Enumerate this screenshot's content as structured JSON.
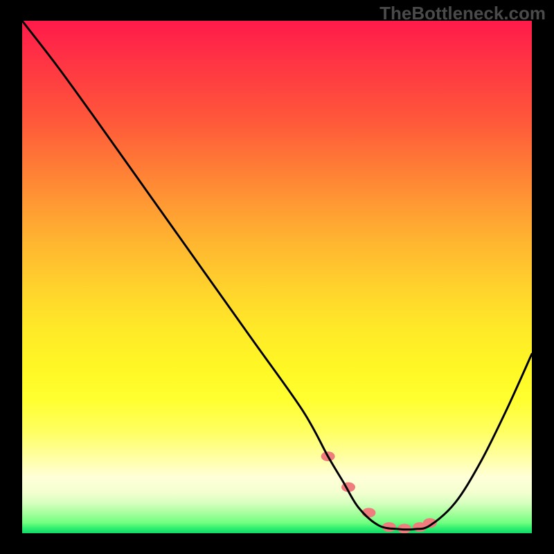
{
  "watermark": "TheBottleneck.com",
  "chart_data": {
    "type": "line",
    "title": "",
    "xlabel": "",
    "ylabel": "",
    "xlim": [
      0,
      100
    ],
    "ylim": [
      0,
      100
    ],
    "series": [
      {
        "name": "curve",
        "x": [
          0,
          7,
          15,
          25,
          35,
          45,
          55,
          60,
          63,
          66,
          70,
          74,
          77,
          80,
          85,
          90,
          95,
          100
        ],
        "values": [
          100,
          91,
          80,
          66,
          52,
          38,
          24,
          15,
          10,
          5,
          1.5,
          0.8,
          0.8,
          1.5,
          6,
          14,
          24,
          35
        ]
      }
    ],
    "markers": {
      "name": "flat-highlight",
      "color": "#ef7d7d",
      "x": [
        60,
        64,
        68,
        72,
        75,
        78,
        80
      ],
      "values": [
        15,
        9,
        4,
        1.2,
        0.9,
        1.2,
        2
      ]
    },
    "gradient_stops": [
      {
        "pos": 0,
        "color": "#ff1a4a"
      },
      {
        "pos": 30,
        "color": "#ff8a34"
      },
      {
        "pos": 60,
        "color": "#ffe928"
      },
      {
        "pos": 85,
        "color": "#ffffc0"
      },
      {
        "pos": 100,
        "color": "#10d868"
      }
    ]
  }
}
